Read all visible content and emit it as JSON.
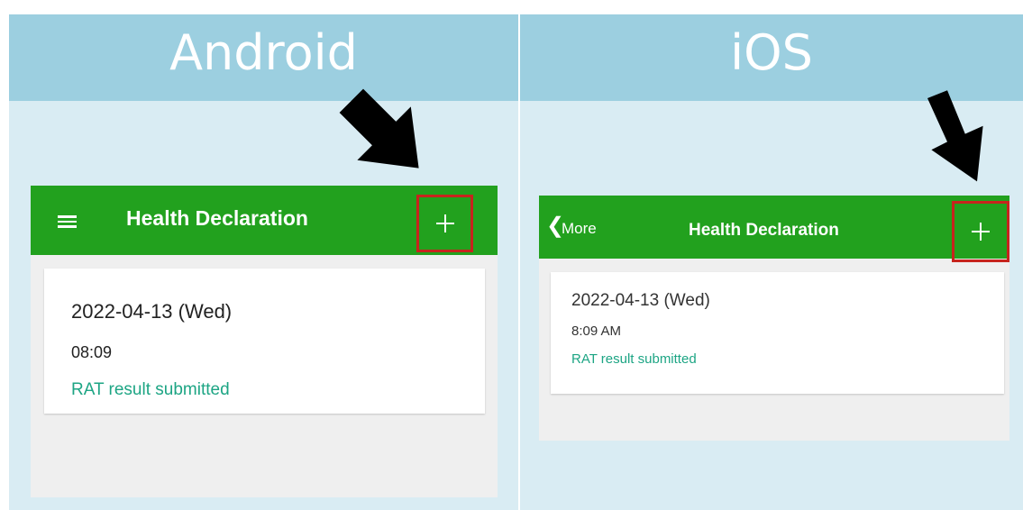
{
  "colors": {
    "header_band": "#9ccfe0",
    "panel_background": "#d9ecf3",
    "app_bar": "#22a11e",
    "highlight_box": "#c7241d",
    "status_text": "#1da584"
  },
  "panels": {
    "android": {
      "title": "Android",
      "phone": {
        "appbar": {
          "menu_icon": "hamburger-menu-icon",
          "title": "Health Declaration",
          "add_icon": "plus-icon"
        },
        "card": {
          "date": "2022-04-13 (Wed)",
          "time": "08:09",
          "status": "RAT result submitted"
        }
      }
    },
    "ios": {
      "title": "iOS",
      "phone": {
        "appbar": {
          "back_icon": "chevron-left-icon",
          "back_label": "More",
          "title": "Health Declaration",
          "add_icon": "plus-icon"
        },
        "card": {
          "date": "2022-04-13 (Wed)",
          "time": "8:09 AM",
          "status": "RAT result submitted"
        }
      }
    }
  },
  "annotations": {
    "pointer_icon": "arrow-down-right-icon"
  }
}
